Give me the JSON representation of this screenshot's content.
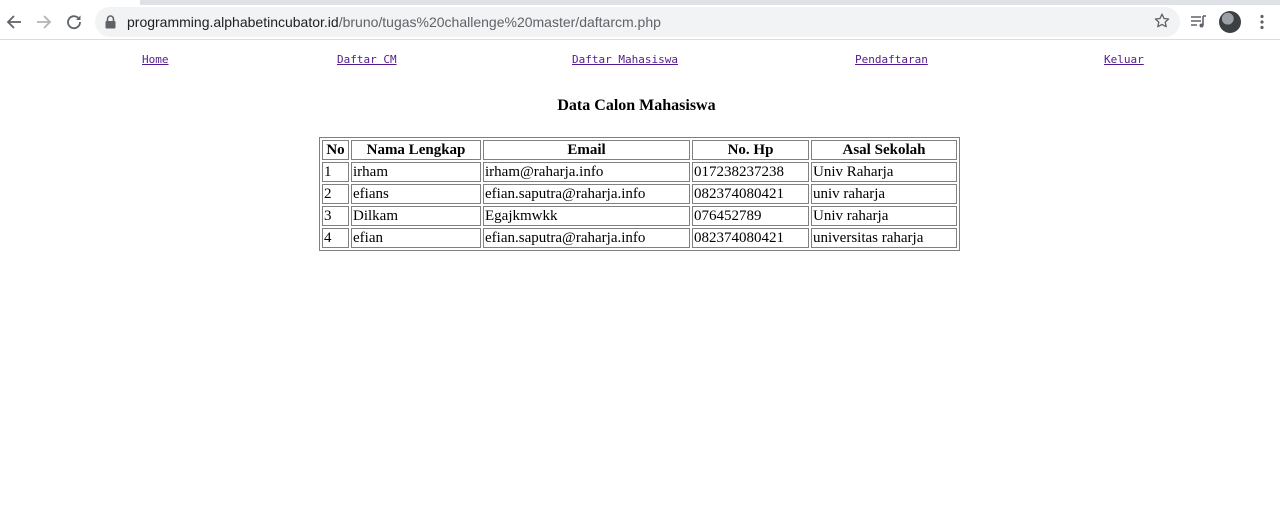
{
  "browser": {
    "url_host": "programming.alphabetincubator.id",
    "url_path": "/bruno/tugas%20challenge%20master/daftarcm.php",
    "icons": {
      "back": "arrow-left-icon",
      "forward": "arrow-right-icon",
      "reload": "reload-icon",
      "lock": "lock-icon",
      "bookmark": "star-icon",
      "media": "media-queue-icon",
      "profile": "avatar",
      "menu": "kebab-menu-icon"
    }
  },
  "nav": {
    "home": "Home",
    "daftar_cm": "Daftar CM",
    "daftar_mahasiswa": "Daftar Mahasiswa",
    "pendaftaran": "Pendaftaran",
    "keluar": "Keluar"
  },
  "colors": {
    "visited_link": "#551a8b",
    "table_border": "#808080"
  },
  "page": {
    "title": "Data Calon Mahasiswa"
  },
  "table": {
    "headers": [
      "No",
      "Nama Lengkap",
      "Email",
      "No. Hp",
      "Asal Sekolah"
    ],
    "rows": [
      [
        "1",
        "irham",
        "irham@raharja.info",
        "017238237238",
        "Univ Raharja"
      ],
      [
        "2",
        "efians",
        "efian.saputra@raharja.info",
        "082374080421",
        "univ raharja"
      ],
      [
        "3",
        "Dilkam",
        "Egajkmwkk",
        "076452789",
        "Univ raharja"
      ],
      [
        "4",
        "efian",
        "efian.saputra@raharja.info",
        "082374080421",
        "universitas raharja"
      ]
    ]
  }
}
